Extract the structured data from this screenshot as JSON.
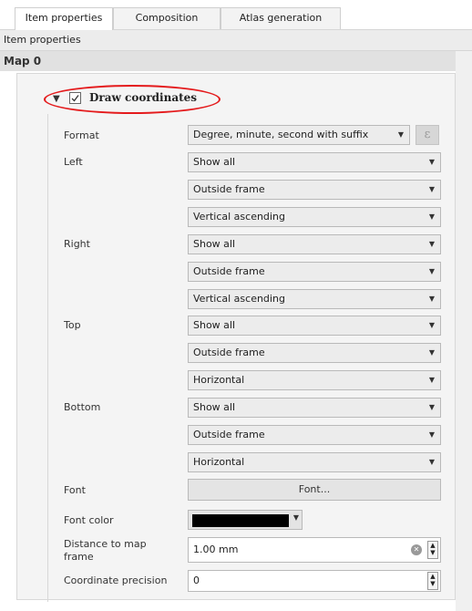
{
  "tabs": [
    {
      "label": "Item properties",
      "active": true
    },
    {
      "label": "Composition",
      "active": false
    },
    {
      "label": "Atlas generation",
      "active": false
    }
  ],
  "title": "Item properties",
  "section": "Map 0",
  "group": {
    "label": "Draw coordinates",
    "checked": true,
    "expanded": true
  },
  "format": {
    "label": "Format",
    "value": "Degree, minute, second with suffix",
    "expr_icon": "epsilon-icon"
  },
  "left": {
    "label": "Left",
    "display": "Show all",
    "position": "Outside frame",
    "direction": "Vertical ascending"
  },
  "right": {
    "label": "Right",
    "display": "Show all",
    "position": "Outside frame",
    "direction": "Vertical ascending"
  },
  "top": {
    "label": "Top",
    "display": "Show all",
    "position": "Outside frame",
    "direction": "Horizontal"
  },
  "bottom": {
    "label": "Bottom",
    "display": "Show all",
    "position": "Outside frame",
    "direction": "Horizontal"
  },
  "font": {
    "label": "Font",
    "button": "Font..."
  },
  "font_color": {
    "label": "Font color",
    "color": "#000000"
  },
  "distance": {
    "label_line1": "Distance to map",
    "label_line2": "frame",
    "value": "1.00 mm"
  },
  "precision": {
    "label": "Coordinate precision",
    "value": "0"
  },
  "colors": {
    "highlight": "#e41a1c"
  }
}
